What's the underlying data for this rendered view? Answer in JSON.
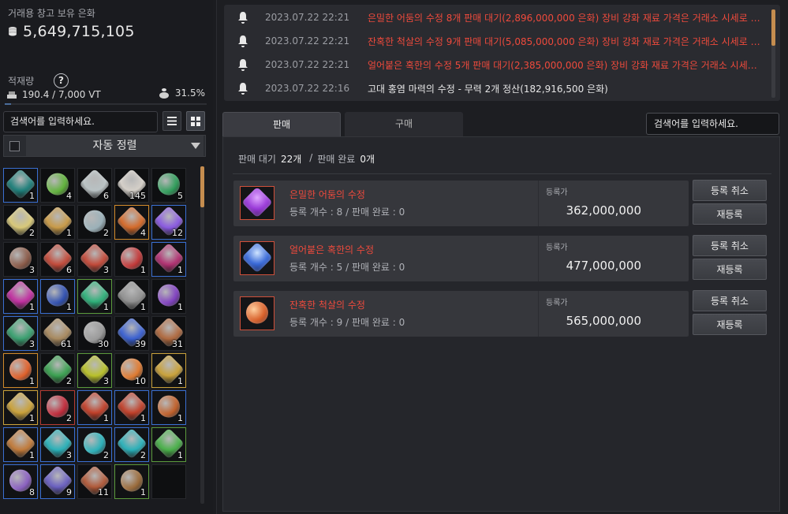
{
  "warehouse": {
    "title": "거래용 창고 보유 은화",
    "silver": "5,649,715,105",
    "capacity_label": "적재량",
    "help": "?",
    "weight": "190.4 / 7,000 VT",
    "tax_percent": "31.5%"
  },
  "left_search": {
    "placeholder": "검색어를 입력하세요."
  },
  "sort": {
    "label": "자동 정렬"
  },
  "inventory": [
    {
      "color": "#1f7f7a",
      "border": "b-blue",
      "count": "1"
    },
    {
      "color": "#5fb13a",
      "border": "b-none",
      "count": "4"
    },
    {
      "color": "#b9c2c4",
      "border": "b-none",
      "count": "6"
    },
    {
      "color": "#d4cfc8",
      "border": "b-none",
      "count": "145"
    },
    {
      "color": "#2f9c5a",
      "border": "b-none",
      "count": "5"
    },
    {
      "color": "#d8c878",
      "border": "b-none",
      "count": "2"
    },
    {
      "color": "#c89a48",
      "border": "b-none",
      "count": "1"
    },
    {
      "color": "#9ab0b8",
      "border": "b-none",
      "count": "2"
    },
    {
      "color": "#d46a2a",
      "border": "b-orange",
      "count": "4"
    },
    {
      "color": "#8a5ae0",
      "border": "b-blue",
      "count": "12"
    },
    {
      "color": "#8a5a48",
      "border": "b-none",
      "count": "3"
    },
    {
      "color": "#c24a3a",
      "border": "b-none",
      "count": "6"
    },
    {
      "color": "#c24a3a",
      "border": "b-none",
      "count": "3"
    },
    {
      "color": "#c23838",
      "border": "b-none",
      "count": "1"
    },
    {
      "color": "#b03070",
      "border": "b-blue",
      "count": "1"
    },
    {
      "color": "#c030a0",
      "border": "b-blue",
      "count": "1"
    },
    {
      "color": "#3050b0",
      "border": "b-blue",
      "count": "1"
    },
    {
      "color": "#2fb07a",
      "border": "b-green",
      "count": "1"
    },
    {
      "color": "#909090",
      "border": "b-none",
      "count": "1"
    },
    {
      "color": "#8040c0",
      "border": "b-none",
      "count": "1"
    },
    {
      "color": "#3aa070",
      "border": "b-blue",
      "count": "3"
    },
    {
      "color": "#a88a60",
      "border": "b-none",
      "count": "61"
    },
    {
      "color": "#9a9a9a",
      "border": "b-none",
      "count": "30"
    },
    {
      "color": "#3a60d0",
      "border": "b-none",
      "count": "39"
    },
    {
      "color": "#b06a40",
      "border": "b-none",
      "count": "31"
    },
    {
      "color": "#e0602a",
      "border": "b-orange",
      "count": "1"
    },
    {
      "color": "#3aa050",
      "border": "b-none",
      "count": "2"
    },
    {
      "color": "#b8c02a",
      "border": "b-green",
      "count": "3"
    },
    {
      "color": "#e07a30",
      "border": "b-none",
      "count": "10"
    },
    {
      "color": "#c9a13a",
      "border": "b-gold",
      "count": "1"
    },
    {
      "color": "#c9a13a",
      "border": "b-gold",
      "count": "1"
    },
    {
      "color": "#c02a3a",
      "border": "b-red",
      "count": "2"
    },
    {
      "color": "#c0402a",
      "border": "b-blue",
      "count": "1"
    },
    {
      "color": "#c0402a",
      "border": "b-blue",
      "count": "1"
    },
    {
      "color": "#c0602a",
      "border": "b-blue",
      "count": "1"
    },
    {
      "color": "#c07a3a",
      "border": "b-blue",
      "count": "1"
    },
    {
      "color": "#2ab0b8",
      "border": "b-blue",
      "count": "3"
    },
    {
      "color": "#2ab0b8",
      "border": "b-blue",
      "count": "2"
    },
    {
      "color": "#2ab0b8",
      "border": "b-blue",
      "count": "2"
    },
    {
      "color": "#4ab04a",
      "border": "b-green",
      "count": "1"
    },
    {
      "color": "#8a60c0",
      "border": "b-blue",
      "count": "8"
    },
    {
      "color": "#6a60c0",
      "border": "b-blue",
      "count": "9"
    },
    {
      "color": "#b05a3a",
      "border": "b-none",
      "count": "11"
    },
    {
      "color": "#9a6a3a",
      "border": "b-green",
      "count": "1"
    },
    {
      "color": "",
      "border": "b-none",
      "count": ""
    }
  ],
  "notifications": [
    {
      "time": "2023.07.22 22:21",
      "message": "은밀한 어둠의 수정 8개 판매 대기(2,896,000,000 은화) 장비 강화 재료 가격은 거래소 시세로 변동",
      "style": "red"
    },
    {
      "time": "2023.07.22 22:21",
      "message": "잔혹한 척살의 수정 9개 판매 대기(5,085,000,000 은화) 장비 강화 재료 가격은 거래소 시세로 변동",
      "style": "red"
    },
    {
      "time": "2023.07.22 22:21",
      "message": "얼어붙은 혹한의 수정 5개 판매 대기(2,385,000,000 은화) 장비 강화 재료 가격은 거래소 시세로 ...",
      "style": "red"
    },
    {
      "time": "2023.07.22 22:16",
      "message": "고대 홍염 마력의 수정 - 무력 2개 정산(182,916,500 은화)",
      "style": "white"
    }
  ],
  "tabs": {
    "sell": "판매",
    "buy": "구매"
  },
  "right_search": {
    "placeholder": "검색어를 입력하세요."
  },
  "summary": {
    "pending_label": "판매 대기",
    "pending_count": "22개",
    "sep": "/",
    "done_label": "판매 완료",
    "done_count": "0개"
  },
  "listings": [
    {
      "name": "은밀한 어둠의 수정",
      "detail": "등록 개수 : 8 / 판매 완료 : 0",
      "price_label": "등록가",
      "price": "362,000,000",
      "color": "#9a3ad8"
    },
    {
      "name": "얼어붙은 혹한의 수정",
      "detail": "등록 개수 : 5 / 판매 완료 : 0",
      "price_label": "등록가",
      "price": "477,000,000",
      "color": "#3a6ad8"
    },
    {
      "name": "잔혹한 척살의 수정",
      "detail": "등록 개수 : 9 / 판매 완료 : 0",
      "price_label": "등록가",
      "price": "565,000,000",
      "color": "#d8602a"
    }
  ],
  "buttons": {
    "cancel": "등록 취소",
    "relist": "재등록"
  },
  "colors": {
    "accent_red": "#ee4a3c",
    "scroll_thumb": "#c58d4f"
  }
}
